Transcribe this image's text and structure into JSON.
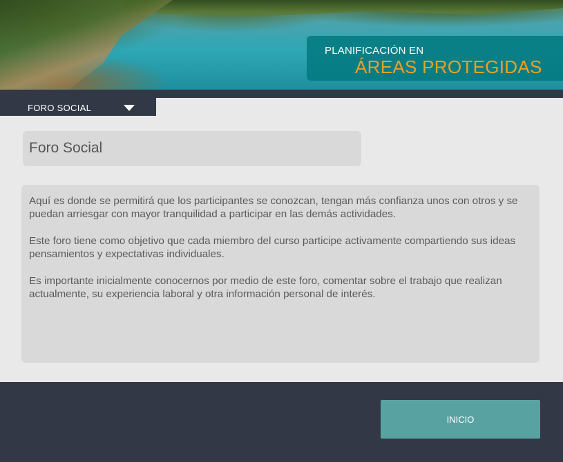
{
  "header": {
    "title_line1": "PLANIFICACIÓN EN",
    "title_line2": "ÁREAS PROTEGIDAS"
  },
  "nav": {
    "dropdown_label": "FORO SOCIAL",
    "dropdown_icon": "triangle-down-icon"
  },
  "main": {
    "heading": "Foro Social",
    "paragraphs": [
      "Aquí es donde se permitirá que los participantes se conozcan, tengan más confianza unos con otros y se puedan arriesgar con mayor tranquilidad a participar en las demás actividades.",
      "Este foro tiene como objetivo que cada miembro del curso participe activamente compartiendo sus ideas pensamientos y expectativas individuales.",
      "Es importante inicialmente conocernos por medio de este foro, comentar sobre el trabajo que realizan actualmente, su experiencia laboral y otra información personal de interés."
    ]
  },
  "footer": {
    "home_button": "INICIO"
  },
  "colors": {
    "dark": "#323845",
    "title_accent": "#f0a020",
    "button": "#59a2a2",
    "panel": "#d9d9d9",
    "background": "#e9e9e9"
  }
}
